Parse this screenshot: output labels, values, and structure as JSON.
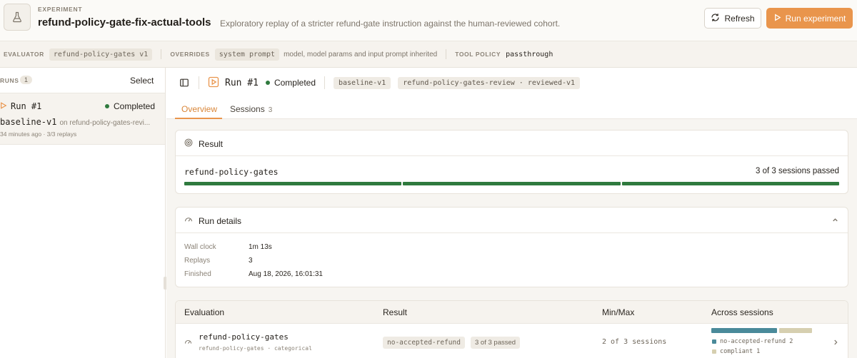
{
  "header": {
    "eyebrow": "EXPERIMENT",
    "title": "refund-policy-gate-fix-actual-tools",
    "subtitle": "Exploratory replay of a stricter refund-gate instruction against the human-reviewed cohort.",
    "refresh_label": "Refresh",
    "run_label": "Run experiment"
  },
  "meta": {
    "evaluator_label": "EVALUATOR",
    "evaluator_value": "refund-policy-gates v1",
    "overrides_label": "OVERRIDES",
    "overrides_value": "system prompt",
    "overrides_note": "model, model params and input prompt inherited",
    "tool_policy_label": "TOOL POLICY",
    "tool_policy_value": "passthrough"
  },
  "runs": {
    "label": "RUNS",
    "count": "1",
    "select_label": "Select",
    "items": [
      {
        "title": "Run #1",
        "status": "Completed",
        "baseline": "baseline-v1",
        "on_text": "on refund-policy-gates-revi...",
        "meta": "34 minutes ago · 3/3 replays"
      }
    ]
  },
  "runbar": {
    "title": "Run #1",
    "status": "Completed",
    "tag1": "baseline-v1",
    "tag2": "refund-policy-gates-review · reviewed-v1"
  },
  "tabs": [
    {
      "label": "Overview",
      "count": ""
    },
    {
      "label": "Sessions",
      "count": "3"
    }
  ],
  "result": {
    "heading": "Result",
    "eval_name": "refund-policy-gates",
    "passed_text": "3 of 3 sessions passed",
    "passed": 3,
    "total": 3
  },
  "details": {
    "heading": "Run details",
    "rows": [
      {
        "label": "Wall clock",
        "value": "1m 13s"
      },
      {
        "label": "Replays",
        "value": "3"
      },
      {
        "label": "Finished",
        "value": "Aug 18, 2026, 16:01:31"
      }
    ]
  },
  "table": {
    "headers": [
      "Evaluation",
      "Result",
      "Min/Max",
      "Across sessions"
    ],
    "rows": [
      {
        "name": "refund-policy-gates",
        "sub": "refund-policy-gates · categorical",
        "result_chip": "no-accepted-refund",
        "passed_chip": "3 of 3 passed",
        "minmax": "2 of 3 sessions",
        "across": [
          {
            "label": "no-accepted-refund 2",
            "count": 2,
            "color": "#4a8a9a"
          },
          {
            "label": "compliant 1",
            "count": 1,
            "color": "#d6cfb0"
          }
        ]
      }
    ]
  },
  "colors": {
    "accent": "#e9954c",
    "success": "#2f7a3e"
  }
}
